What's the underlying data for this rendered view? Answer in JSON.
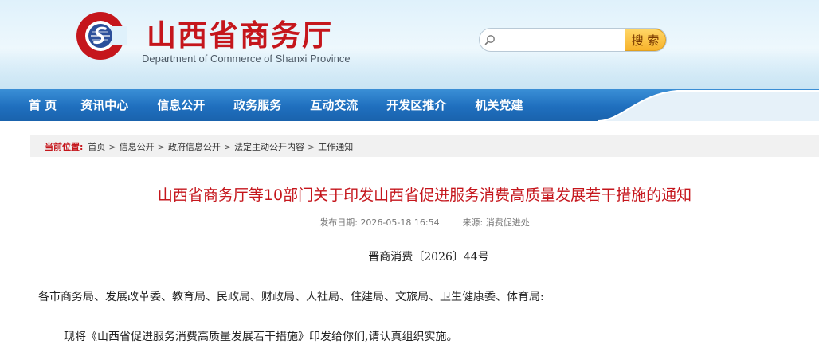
{
  "header": {
    "site_title": "山西省商务厅",
    "site_subtitle": "Department of Commerce of Shanxi Province",
    "logo_icon": "shanxi-commerce-logo",
    "search": {
      "placeholder": "",
      "value": "",
      "button_label": "搜 索"
    }
  },
  "nav": {
    "items": [
      {
        "label": "首 页"
      },
      {
        "label": "资讯中心"
      },
      {
        "label": "信息公开"
      },
      {
        "label": "政务服务"
      },
      {
        "label": "互动交流"
      },
      {
        "label": "开发区推介"
      },
      {
        "label": "机关党建"
      }
    ]
  },
  "breadcrumb": {
    "label": "当前位置:",
    "separator": ">",
    "items": [
      "首页",
      "信息公开",
      "政府信息公开",
      "法定主动公开内容",
      "工作通知"
    ]
  },
  "article": {
    "title": "山西省商务厅等10部门关于印发山西省促进服务消费高质量发展若干措施的通知",
    "date_label": "发布日期:",
    "date_value": "2026-05-18 16:54",
    "source_label": "来源:",
    "source_value": "消费促进处",
    "doc_number": "晋商消费〔2026〕44号",
    "recipients": "各市商务局、发展改革委、教育局、民政局、财政局、人社局、住建局、文旅局、卫生健康委、体育局:",
    "body_paragraph": "现将《山西省促进服务消费高质量发展若干措施》印发给你们,请认真组织实施。"
  },
  "colors": {
    "brand_red": "#c5161c",
    "nav_blue": "#1f6fbe",
    "search_button": "#f7b32b"
  }
}
